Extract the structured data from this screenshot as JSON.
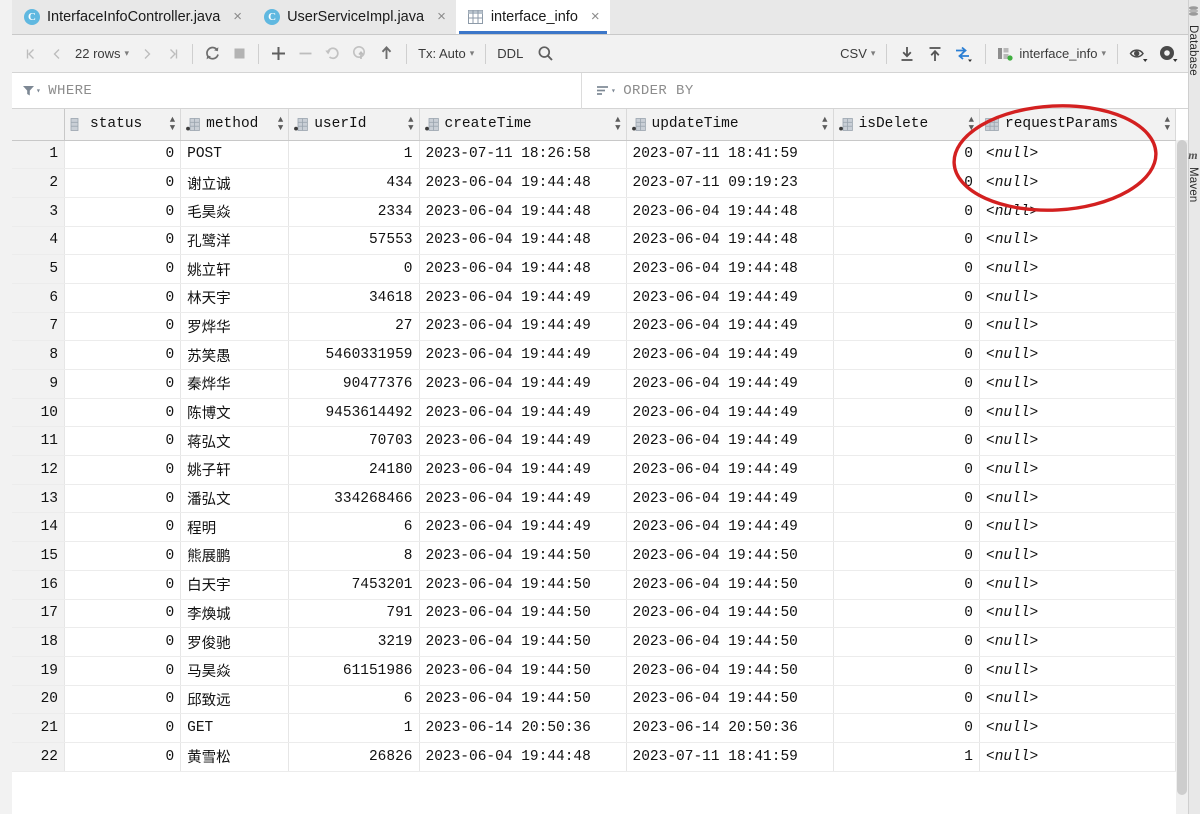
{
  "window": {
    "title": "interface_info"
  },
  "tabs": [
    {
      "label": "InterfaceInfoController.java",
      "icon": "java-class-icon",
      "close": "×",
      "active": false
    },
    {
      "label": "UserServiceImpl.java",
      "icon": "java-class-icon",
      "close": "×",
      "active": false
    },
    {
      "label": "interface_info",
      "icon": "table-icon",
      "close": "×",
      "active": true
    }
  ],
  "toolbar": {
    "first_page": "|⟨",
    "prev_page": "⟨",
    "rows_label": "22 rows",
    "next_page": "⟩",
    "last_page": "⟩|",
    "reload": "↻",
    "stop": "■",
    "add_row": "+",
    "remove_row": "−",
    "revert": "↺",
    "revert_selected": "⟲",
    "submit": "↑",
    "tx_label": "Tx: Auto",
    "ddl_label": "DDL",
    "search": "🔍",
    "format_label": "CSV",
    "export_label": "download-icon",
    "import_label": "upload-icon",
    "compare_label": "compare-icon",
    "datasource_label": "interface_info",
    "view_options": "eye-icon",
    "settings": "gear-icon"
  },
  "filterbar": {
    "where_label": "WHERE",
    "where_value": "",
    "orderby_label": "ORDER BY",
    "orderby_value": ""
  },
  "grid": {
    "columns": [
      {
        "name": "status",
        "type_icon": "column-icon",
        "sort": "↕",
        "align": "num"
      },
      {
        "name": "method",
        "type_icon": "key-column-icon",
        "sort": "↕",
        "align": "txt"
      },
      {
        "name": "userId",
        "type_icon": "key-column-icon",
        "sort": "↕",
        "align": "num"
      },
      {
        "name": "createTime",
        "type_icon": "key-column-icon",
        "sort": "↕",
        "align": "txt"
      },
      {
        "name": "updateTime",
        "type_icon": "key-column-icon",
        "sort": "↕",
        "align": "txt"
      },
      {
        "name": "isDelete",
        "type_icon": "key-column-icon",
        "sort": "↕",
        "align": "num"
      },
      {
        "name": "requestParams",
        "type_icon": "column-icon",
        "sort": "↕",
        "align": "txt"
      }
    ],
    "null_text": "<null>",
    "rows": [
      {
        "n": "1",
        "status": "0",
        "method": "POST",
        "userId": "1",
        "createTime": "2023-07-11 18:26:58",
        "updateTime": "2023-07-11 18:41:59",
        "isDelete": "0",
        "requestParams": "<null>"
      },
      {
        "n": "2",
        "status": "0",
        "method": "谢立诚",
        "userId": "434",
        "createTime": "2023-06-04 19:44:48",
        "updateTime": "2023-07-11 09:19:23",
        "isDelete": "0",
        "requestParams": "<null>"
      },
      {
        "n": "3",
        "status": "0",
        "method": "毛昊焱",
        "userId": "2334",
        "createTime": "2023-06-04 19:44:48",
        "updateTime": "2023-06-04 19:44:48",
        "isDelete": "0",
        "requestParams": "<null>"
      },
      {
        "n": "4",
        "status": "0",
        "method": "孔鹭洋",
        "userId": "57553",
        "createTime": "2023-06-04 19:44:48",
        "updateTime": "2023-06-04 19:44:48",
        "isDelete": "0",
        "requestParams": "<null>"
      },
      {
        "n": "5",
        "status": "0",
        "method": "姚立轩",
        "userId": "0",
        "createTime": "2023-06-04 19:44:48",
        "updateTime": "2023-06-04 19:44:48",
        "isDelete": "0",
        "requestParams": "<null>"
      },
      {
        "n": "6",
        "status": "0",
        "method": "林天宇",
        "userId": "34618",
        "createTime": "2023-06-04 19:44:49",
        "updateTime": "2023-06-04 19:44:49",
        "isDelete": "0",
        "requestParams": "<null>"
      },
      {
        "n": "7",
        "status": "0",
        "method": "罗烨华",
        "userId": "27",
        "createTime": "2023-06-04 19:44:49",
        "updateTime": "2023-06-04 19:44:49",
        "isDelete": "0",
        "requestParams": "<null>"
      },
      {
        "n": "8",
        "status": "0",
        "method": "苏笑愚",
        "userId": "5460331959",
        "createTime": "2023-06-04 19:44:49",
        "updateTime": "2023-06-04 19:44:49",
        "isDelete": "0",
        "requestParams": "<null>"
      },
      {
        "n": "9",
        "status": "0",
        "method": "秦烨华",
        "userId": "90477376",
        "createTime": "2023-06-04 19:44:49",
        "updateTime": "2023-06-04 19:44:49",
        "isDelete": "0",
        "requestParams": "<null>"
      },
      {
        "n": "10",
        "status": "0",
        "method": "陈博文",
        "userId": "9453614492",
        "createTime": "2023-06-04 19:44:49",
        "updateTime": "2023-06-04 19:44:49",
        "isDelete": "0",
        "requestParams": "<null>"
      },
      {
        "n": "11",
        "status": "0",
        "method": "蒋弘文",
        "userId": "70703",
        "createTime": "2023-06-04 19:44:49",
        "updateTime": "2023-06-04 19:44:49",
        "isDelete": "0",
        "requestParams": "<null>"
      },
      {
        "n": "12",
        "status": "0",
        "method": "姚子轩",
        "userId": "24180",
        "createTime": "2023-06-04 19:44:49",
        "updateTime": "2023-06-04 19:44:49",
        "isDelete": "0",
        "requestParams": "<null>"
      },
      {
        "n": "13",
        "status": "0",
        "method": "潘弘文",
        "userId": "334268466",
        "createTime": "2023-06-04 19:44:49",
        "updateTime": "2023-06-04 19:44:49",
        "isDelete": "0",
        "requestParams": "<null>"
      },
      {
        "n": "14",
        "status": "0",
        "method": "程明",
        "userId": "6",
        "createTime": "2023-06-04 19:44:49",
        "updateTime": "2023-06-04 19:44:49",
        "isDelete": "0",
        "requestParams": "<null>"
      },
      {
        "n": "15",
        "status": "0",
        "method": "熊展鹏",
        "userId": "8",
        "createTime": "2023-06-04 19:44:50",
        "updateTime": "2023-06-04 19:44:50",
        "isDelete": "0",
        "requestParams": "<null>"
      },
      {
        "n": "16",
        "status": "0",
        "method": "白天宇",
        "userId": "7453201",
        "createTime": "2023-06-04 19:44:50",
        "updateTime": "2023-06-04 19:44:50",
        "isDelete": "0",
        "requestParams": "<null>"
      },
      {
        "n": "17",
        "status": "0",
        "method": "李煥城",
        "userId": "791",
        "createTime": "2023-06-04 19:44:50",
        "updateTime": "2023-06-04 19:44:50",
        "isDelete": "0",
        "requestParams": "<null>"
      },
      {
        "n": "18",
        "status": "0",
        "method": "罗俊驰",
        "userId": "3219",
        "createTime": "2023-06-04 19:44:50",
        "updateTime": "2023-06-04 19:44:50",
        "isDelete": "0",
        "requestParams": "<null>"
      },
      {
        "n": "19",
        "status": "0",
        "method": "马昊焱",
        "userId": "61151986",
        "createTime": "2023-06-04 19:44:50",
        "updateTime": "2023-06-04 19:44:50",
        "isDelete": "0",
        "requestParams": "<null>"
      },
      {
        "n": "20",
        "status": "0",
        "method": "邱致远",
        "userId": "6",
        "createTime": "2023-06-04 19:44:50",
        "updateTime": "2023-06-04 19:44:50",
        "isDelete": "0",
        "requestParams": "<null>"
      },
      {
        "n": "21",
        "status": "0",
        "method": "GET",
        "userId": "1",
        "createTime": "2023-06-14 20:50:36",
        "updateTime": "2023-06-14 20:50:36",
        "isDelete": "0",
        "requestParams": "<null>"
      },
      {
        "n": "22",
        "status": "0",
        "method": "黄雪松",
        "userId": "26826",
        "createTime": "2023-06-04 19:44:48",
        "updateTime": "2023-07-11 18:41:59",
        "isDelete": "1",
        "requestParams": "<null>"
      }
    ]
  },
  "right_toolwindows": [
    {
      "label": "Database",
      "icon": "database-icon"
    },
    {
      "label": "Maven",
      "icon": "maven-icon"
    }
  ],
  "annotation": {
    "shape": "ellipse",
    "color": "#d32020",
    "target": "requestParams"
  },
  "colors": {
    "accent": "#3c77c9",
    "annotation_red": "#d32020",
    "toolbar_bg": "#f2f2f2",
    "tab_bg": "#e8e8e8",
    "grid_bg": "#ffffff",
    "null_text": "#a9a9a9"
  }
}
